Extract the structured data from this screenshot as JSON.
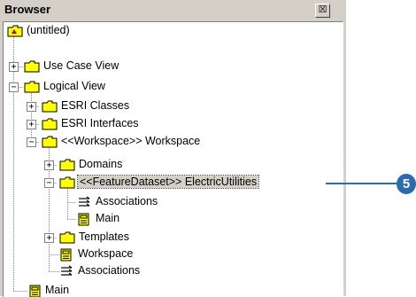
{
  "window": {
    "title": "Browser",
    "close_glyph": "☒"
  },
  "tree": {
    "root": "(untitled)",
    "items": [
      {
        "label": "Use Case View"
      },
      {
        "label": "Logical View"
      },
      {
        "label": "ESRI Classes"
      },
      {
        "label": "ESRI Interfaces"
      },
      {
        "label": "<<Workspace>> Workspace"
      },
      {
        "label": "Domains"
      },
      {
        "label": "<<FeatureDataset>> ElectricUtilities"
      },
      {
        "label": "Associations"
      },
      {
        "label": "Main"
      },
      {
        "label": "Templates"
      },
      {
        "label": "Workspace"
      },
      {
        "label": "Associations"
      },
      {
        "label": "Main"
      }
    ]
  },
  "callout": {
    "number": "5",
    "color": "#2b6cb0"
  }
}
